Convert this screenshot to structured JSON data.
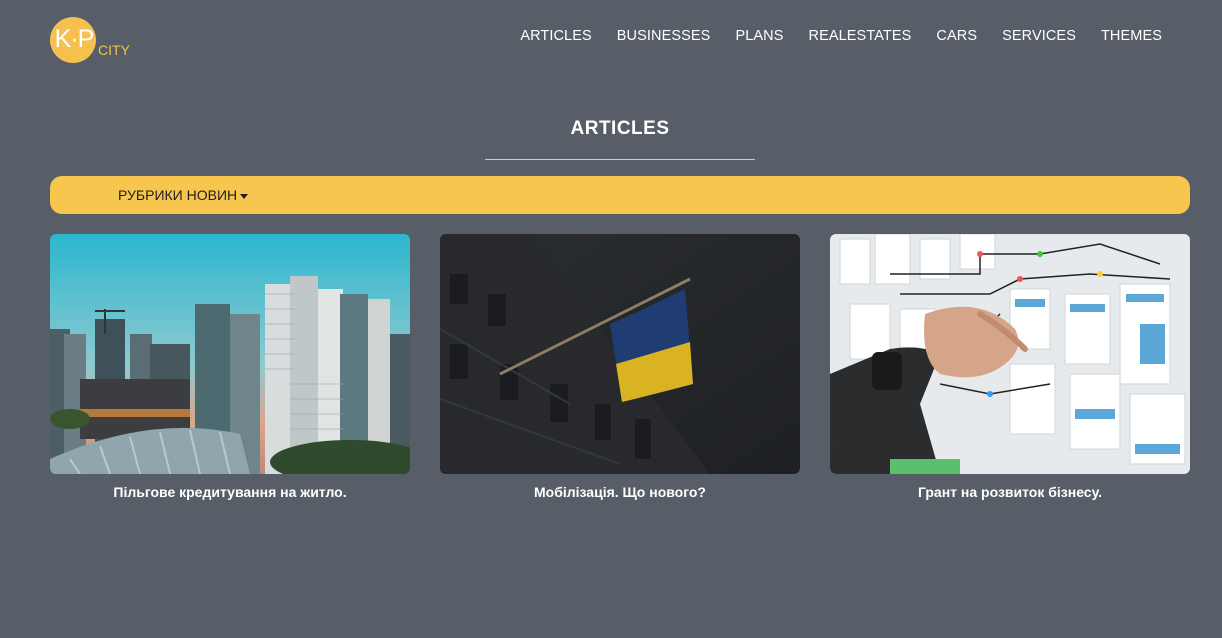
{
  "header": {
    "logo_mark": "K·P",
    "logo_text": "CITY",
    "nav": [
      {
        "label": "ARTICLES"
      },
      {
        "label": "BUSINESSES"
      },
      {
        "label": "PLANS"
      },
      {
        "label": "REALESTATES"
      },
      {
        "label": "CARS"
      },
      {
        "label": "SERVICES"
      },
      {
        "label": "THEMES"
      }
    ]
  },
  "main": {
    "title": "ARTICLES",
    "category_dropdown": "РУБРИКИ НОВИН",
    "cards": [
      {
        "title": "Пільгове кредитування на житло.",
        "image": "city-skyline-photo"
      },
      {
        "title": "Мобілізація. Що нового?",
        "image": "ukrainian-flag-photo"
      },
      {
        "title": "Грант на розвиток бізнесу.",
        "image": "planning-board-photo"
      }
    ]
  },
  "colors": {
    "background": "#585e67",
    "accent": "#f6c64f",
    "text": "#ffffff"
  }
}
